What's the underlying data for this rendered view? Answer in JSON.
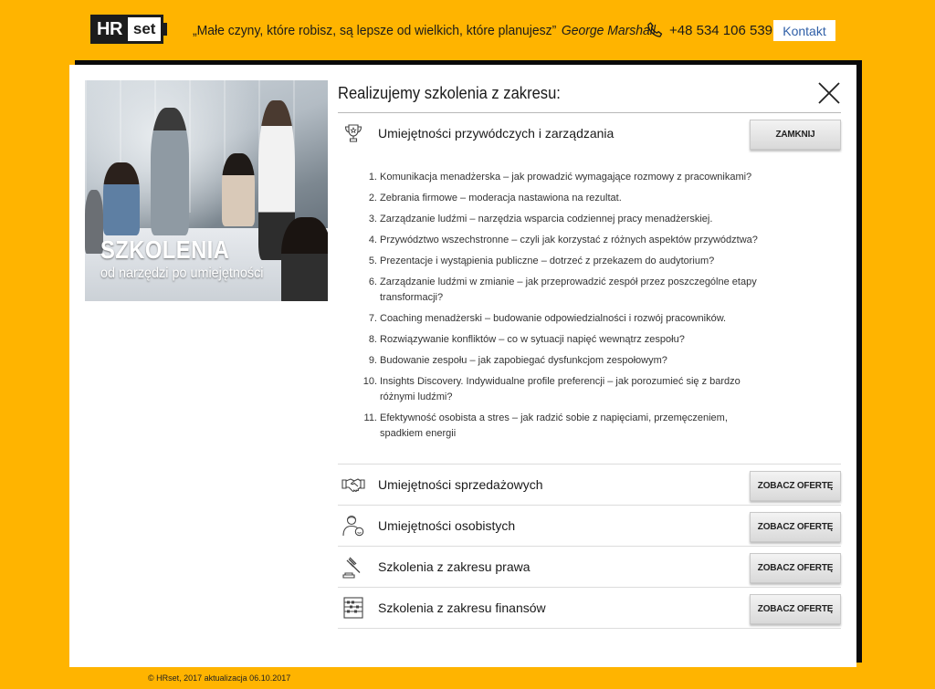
{
  "header": {
    "logo_hr": "HR",
    "logo_set": "set",
    "quote": "„Małe czyny, które robisz, są lepsze od wielkich, które planujesz”",
    "quote_author": "George Marshall",
    "phone": "+48 534 106 539",
    "contact_label": "Kontakt"
  },
  "hero": {
    "title": "SZKOLENIA",
    "subtitle": "od narzędzi po umiejętności"
  },
  "panel": {
    "heading": "Realizujemy szkolenia z zakresu:",
    "open_category": {
      "title": "Umiejętności przywódczych i zarządzania",
      "icon": "trophy-icon",
      "button": "ZAMKNIJ",
      "items": [
        {
          "n": "1.",
          "text": "Komunikacja menadżerska – jak prowadzić wymagające rozmowy z pracownikami?"
        },
        {
          "n": "2.",
          "text": "Zebrania firmowe – moderacja nastawiona na rezultat."
        },
        {
          "n": "3.",
          "text": "Zarządzanie ludźmi – narzędzia wsparcia codziennej pracy menadżerskiej."
        },
        {
          "n": "4.",
          "text": "Przywództwo wszechstronne – czyli jak korzystać z różnych aspektów przywództwa?"
        },
        {
          "n": "5.",
          "text": "Prezentacje i wystąpienia publiczne – dotrzeć z przekazem do audytorium?"
        },
        {
          "n": "6.",
          "text": "Zarządzanie ludźmi w zmianie – jak przeprowadzić zespół przez poszczególne etapy transformacji?"
        },
        {
          "n": "7.",
          "text": "Coaching menadżerski – budowanie odpowiedzialności i rozwój pracowników."
        },
        {
          "n": "8.",
          "text": "Rozwiązywanie konfliktów – co w sytuacji napięć wewnątrz zespołu?"
        },
        {
          "n": "9.",
          "text": "Budowanie zespołu – jak zapobiegać dysfunkcjom zespołowym?"
        },
        {
          "n": "10.",
          "text": "Insights Discovery. Indywidualne profile preferencji – jak porozumieć się z bardzo różnymi ludźmi?"
        },
        {
          "n": "11.",
          "text": "Efektywność osobista a stres – jak radzić sobie z napięciami, przemęczeniem, spadkiem energii"
        }
      ]
    },
    "categories": [
      {
        "title": "Umiejętności sprzedażowych",
        "icon": "handshake-icon",
        "button": "ZOBACZ OFERTĘ"
      },
      {
        "title": "Umiejętności osobistych",
        "icon": "person-icon",
        "button": "ZOBACZ OFERTĘ"
      },
      {
        "title": "Szkolenia z zakresu prawa",
        "icon": "gavel-icon",
        "button": "ZOBACZ OFERTĘ"
      },
      {
        "title": "Szkolenia z zakresu finansów",
        "icon": "abacus-icon",
        "button": "ZOBACZ OFERTĘ"
      }
    ]
  },
  "footer": {
    "text": "© HRset, 2017 aktualizacja 06.10.2017"
  },
  "colors": {
    "background": "#FFB400",
    "contact_text": "#2f5fa7"
  }
}
